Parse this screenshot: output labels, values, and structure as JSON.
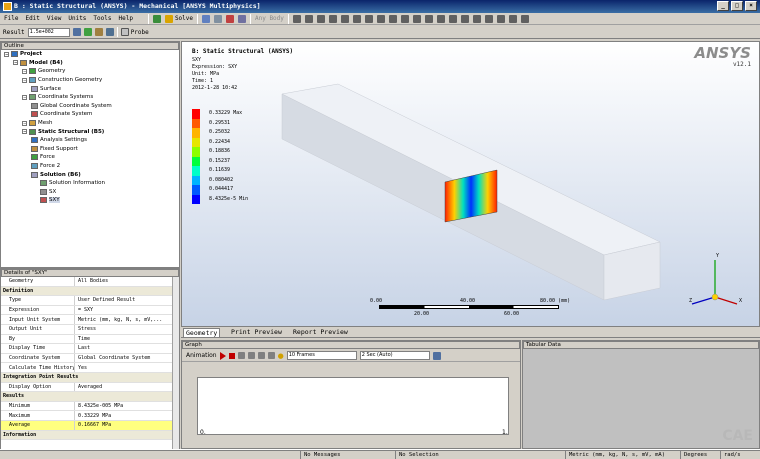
{
  "window": {
    "title": "B : Static Structural (ANSYS) - Mechanical [ANSYS Multiphysics]",
    "controls": [
      "_",
      "□",
      "×"
    ]
  },
  "menu": [
    "File",
    "Edit",
    "View",
    "Units",
    "Tools",
    "Help"
  ],
  "toolbar": {
    "solve_label": "Solve",
    "result_label": "Result",
    "result_scale": "1.5e+002 (Auto Scale)",
    "probe_label": "Probe",
    "any_body_label": "Any Body"
  },
  "outline": {
    "title": "Outline",
    "items": [
      {
        "label": "Project",
        "level": 0,
        "bold": true
      },
      {
        "label": "Model (B4)",
        "level": 1,
        "bold": true
      },
      {
        "label": "Geometry",
        "level": 2
      },
      {
        "label": "Construction Geometry",
        "level": 2
      },
      {
        "label": "Surface",
        "level": 3
      },
      {
        "label": "Coordinate Systems",
        "level": 2
      },
      {
        "label": "Global Coordinate System",
        "level": 3
      },
      {
        "label": "Coordinate System",
        "level": 3
      },
      {
        "label": "Mesh",
        "level": 2
      },
      {
        "label": "Static Structural (B5)",
        "level": 2,
        "bold": true
      },
      {
        "label": "Analysis Settings",
        "level": 3
      },
      {
        "label": "Fixed Support",
        "level": 3
      },
      {
        "label": "Force",
        "level": 3
      },
      {
        "label": "Force 2",
        "level": 3
      },
      {
        "label": "Solution (B6)",
        "level": 3,
        "bold": true
      },
      {
        "label": "Solution Information",
        "level": 4
      },
      {
        "label": "SX",
        "level": 4
      },
      {
        "label": "SXY",
        "level": 4
      }
    ]
  },
  "details": {
    "title": "Details of \"SXY\"",
    "rows": [
      {
        "k": "Geometry",
        "v": "All Bodies"
      },
      {
        "group": "Definition"
      },
      {
        "k": "Type",
        "v": "User Defined Result"
      },
      {
        "k": "Expression",
        "v": "= SXY"
      },
      {
        "k": "Input Unit System",
        "v": "Metric (mm, kg, N, s, mV,..."
      },
      {
        "k": "Output Unit",
        "v": "Stress"
      },
      {
        "k": "By",
        "v": "Time"
      },
      {
        "k": "Display Time",
        "v": "Last"
      },
      {
        "k": "Coordinate System",
        "v": "Global Coordinate System"
      },
      {
        "k": "Calculate Time History",
        "v": "Yes"
      },
      {
        "group": "Integration Point Results"
      },
      {
        "k": "Display Option",
        "v": "Averaged"
      },
      {
        "group": "Results"
      },
      {
        "k": "Minimum",
        "v": "8.4325e-005 MPa"
      },
      {
        "k": "Maximum",
        "v": "0.33229 MPa"
      },
      {
        "k": "Average",
        "v": "0.16667 MPa",
        "hl": true
      },
      {
        "group": "Information"
      }
    ]
  },
  "viewport": {
    "heading": "B: Static Structural (ANSYS)",
    "result": "SXY",
    "expression": "Expression: SXY",
    "unit": "Unit: MPa",
    "time": "Time: 1",
    "date": "2012-1-28 10:42",
    "logo": "ANSYS",
    "version": "v12.1",
    "legend": [
      {
        "label": "0.33229 Max",
        "color": "#ff0000"
      },
      {
        "label": "0.29531",
        "color": "#ff5a00"
      },
      {
        "label": "0.25032",
        "color": "#ffb400"
      },
      {
        "label": "0.22434",
        "color": "#e6e600"
      },
      {
        "label": "0.18836",
        "color": "#8cff00"
      },
      {
        "label": "0.15237",
        "color": "#00ff3c"
      },
      {
        "label": "0.11639",
        "color": "#00ffc8"
      },
      {
        "label": "0.080402",
        "color": "#00b4ff"
      },
      {
        "label": "0.044417",
        "color": "#005aff"
      },
      {
        "label": "8.4325e-5 Min",
        "color": "#0000ff"
      }
    ],
    "scale": {
      "top": [
        "0.00",
        "40.00",
        "80.00 (mm)"
      ],
      "bottom": [
        "20.00",
        "60.00"
      ]
    },
    "axes": [
      "X",
      "Y",
      "Z"
    ]
  },
  "tabs": [
    "Geometry",
    "Print Preview",
    "Report Preview"
  ],
  "graph": {
    "title": "Graph",
    "animation_label": "Animation",
    "frames": "10 Frames",
    "duration": "2 Sec (Auto)",
    "x_start": "0.",
    "x_end": "1."
  },
  "tabular": {
    "title": "Tabular Data"
  },
  "status": {
    "messages": "No Messages",
    "selection": "No Selection",
    "units": "Metric (mm, kg, N, s, mV, mA)",
    "degrees": "Degrees",
    "rads": "rad/s"
  },
  "watermark": "CAE"
}
